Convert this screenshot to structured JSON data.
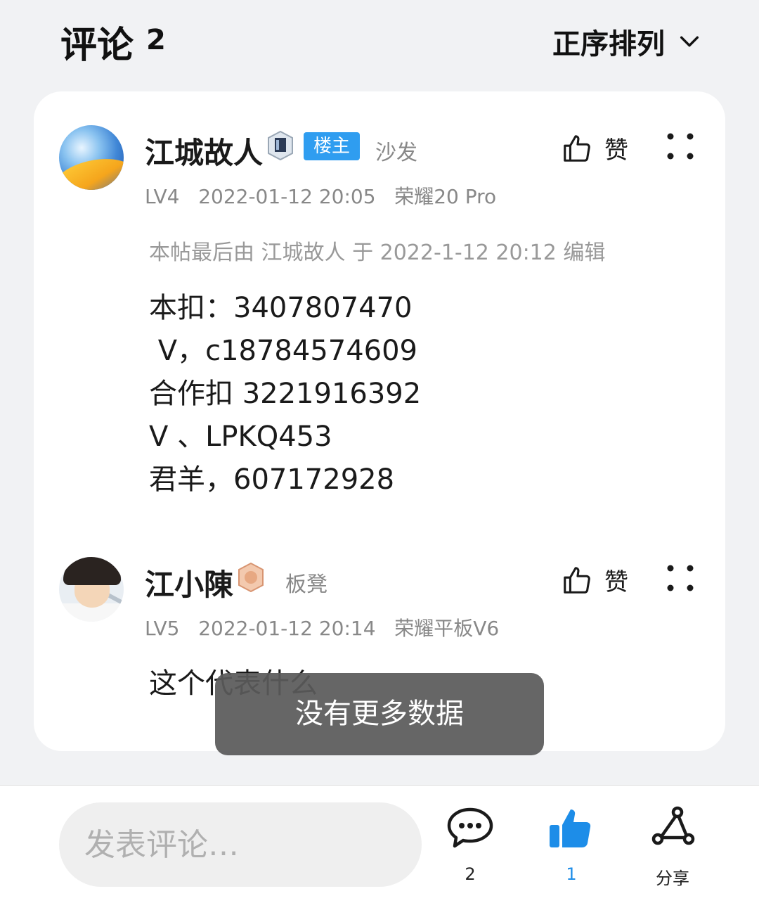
{
  "header": {
    "title": "评论",
    "count": "2",
    "sort_label": "正序排列"
  },
  "comments": [
    {
      "username": "江城故人",
      "badge": "楼主",
      "floor": "沙发",
      "like_label": "赞",
      "meta": "LV4   2022-01-12 20:05   荣耀20 Pro",
      "edit_note": "本帖最后由 江城故人 于 2022-1-12 20:12 编辑",
      "content_lines": [
        "本扣：3407807470",
        " V，c18784574609",
        "合作扣 3221916392",
        "V 、LPKQ453",
        "君羊，607172928"
      ]
    },
    {
      "username": "江小陳",
      "floor": "板凳",
      "like_label": "赞",
      "meta": "LV5   2022-01-12 20:14   荣耀平板V6",
      "content_lines": [
        "这个代表什么"
      ]
    }
  ],
  "toast": "没有更多数据",
  "bottom_bar": {
    "input_placeholder": "发表评论…",
    "comment_count": "2",
    "like_count": "1",
    "share_label": "分享"
  },
  "icons": {
    "sort": "chevron-down-icon",
    "like": "thumbs-up-icon",
    "more": "more-dots-icon",
    "comment": "comment-bubble-icon",
    "liked": "thumbs-up-filled-icon",
    "share": "share-icon"
  },
  "colors": {
    "accent_blue": "#2f9df0",
    "liked_blue": "#1d8de8",
    "background": "#f1f2f4"
  }
}
